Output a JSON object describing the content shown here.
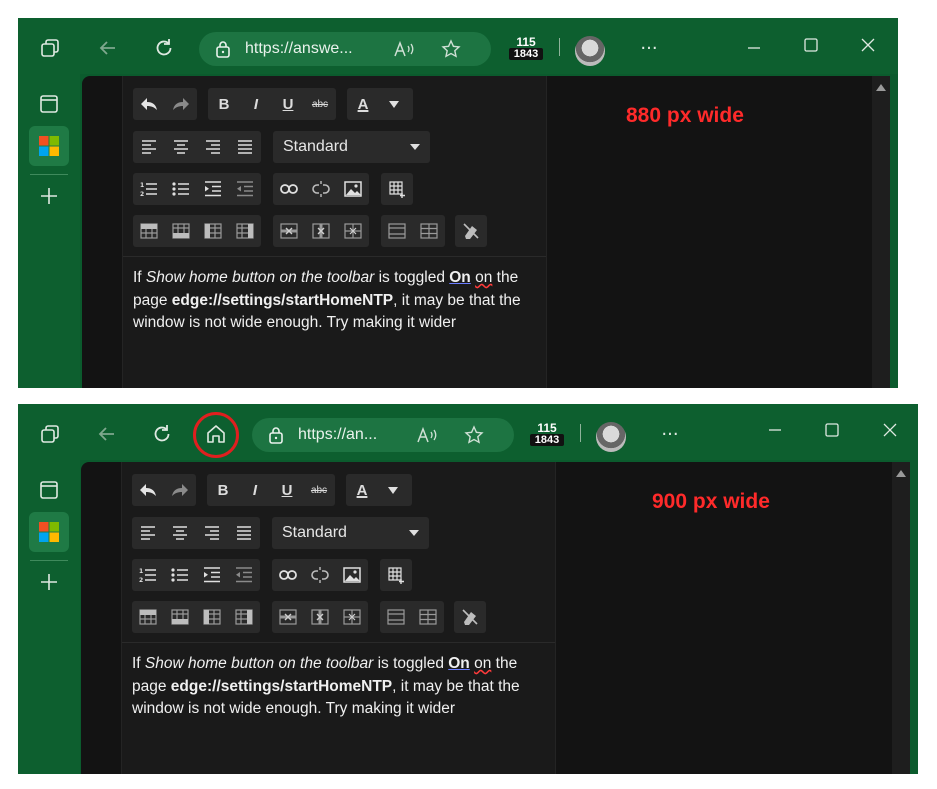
{
  "screenshots": [
    {
      "url": "https://answe...",
      "counter_top": "115",
      "counter_bottom": "1843",
      "width_label": "880 px wide",
      "show_home": false
    },
    {
      "url": "https://an...",
      "counter_top": "115",
      "counter_bottom": "1843",
      "width_label": "900 px wide",
      "show_home": true
    }
  ],
  "editor": {
    "font_select": "Standard",
    "toolbar": {
      "bold": "B",
      "italic": "I",
      "underline": "U",
      "strike": "abc",
      "font_color": "A"
    },
    "paragraph": {
      "t1": "If ",
      "t2": "Show home button on the toolbar",
      "t3": " is toggled ",
      "t4": "On",
      "t5": " ",
      "t6": "on",
      "t7": " the page ",
      "t8": "edge://settings/startHomeNTP",
      "t9": ", it may be that the window is not wide enough. Try making it wider"
    }
  },
  "colors": {
    "browser_frame": "#0d5f2f",
    "annotation": "#ff2a2a"
  },
  "icons": [
    "tab-actions-icon",
    "back-icon",
    "refresh-icon",
    "home-icon",
    "lock-icon",
    "read-aloud-icon",
    "favorite-icon",
    "more-icon",
    "minimize-icon",
    "maximize-icon",
    "close-icon",
    "vertical-tabs-icon",
    "microsoft-start-icon",
    "add-icon"
  ]
}
